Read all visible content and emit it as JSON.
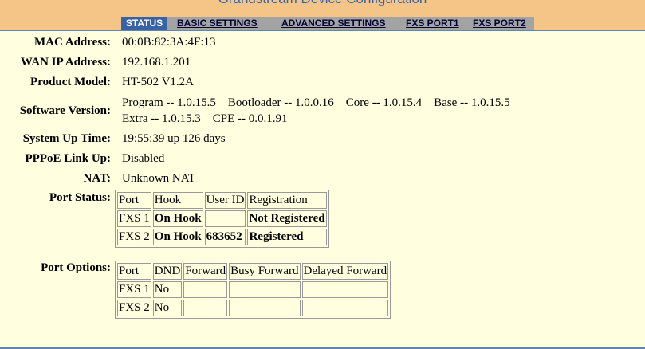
{
  "header": {
    "title": "Grandstream Device Configuration"
  },
  "nav": {
    "status": "STATUS",
    "basic": "BASIC SETTINGS",
    "advanced": "ADVANCED SETTINGS",
    "fxs1": "FXS PORT1",
    "fxs2": "FXS PORT2"
  },
  "fields": {
    "mac": {
      "label": "MAC Address:",
      "value": "00:0B:82:3A:4F:13"
    },
    "wan_ip": {
      "label": "WAN IP Address:",
      "value": "192.168.1.201"
    },
    "model": {
      "label": "Product Model:",
      "value": "HT-502 V1.2A"
    },
    "software": {
      "label": "Software Version:",
      "line1": "Program -- 1.0.15.5    Bootloader -- 1.0.0.16    Core -- 1.0.15.4    Base -- 1.0.15.5",
      "line2": "Extra -- 1.0.15.3    CPE -- 0.0.1.91"
    },
    "uptime": {
      "label": "System Up Time:",
      "value": "19:55:39 up 126 days"
    },
    "pppoe": {
      "label": "PPPoE Link Up:",
      "value": "Disabled"
    },
    "nat": {
      "label": "NAT:",
      "value": "Unknown NAT"
    }
  },
  "port_status": {
    "label": "Port Status:",
    "headers": [
      "Port",
      "Hook",
      "User ID",
      "Registration"
    ],
    "rows": [
      [
        "FXS 1",
        "On Hook",
        "",
        "Not Registered"
      ],
      [
        "FXS 2",
        "On Hook",
        "683652",
        "Registered"
      ]
    ]
  },
  "port_options": {
    "label": "Port Options:",
    "headers": [
      "Port",
      "DND",
      "Forward",
      "Busy Forward",
      "Delayed Forward"
    ],
    "rows": [
      [
        "FXS 1",
        "No",
        "",
        "",
        ""
      ],
      [
        "FXS 2",
        "No",
        "",
        "",
        ""
      ]
    ]
  }
}
